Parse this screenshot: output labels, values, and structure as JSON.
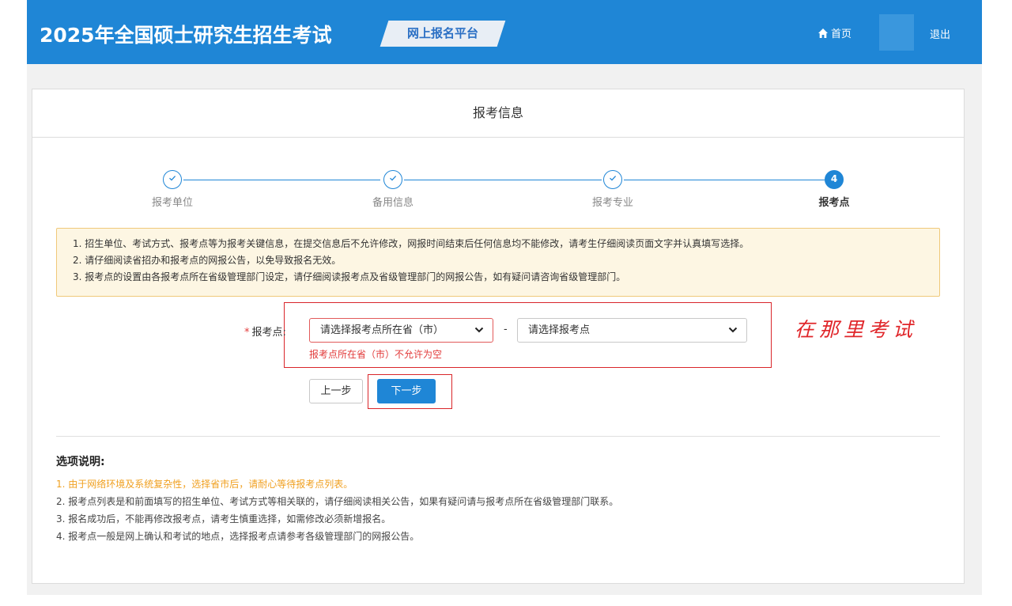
{
  "header": {
    "title": "2025年全国硕士研究生招生考试",
    "platform": "网上报名平台",
    "home_label": "首页",
    "logout_label": "退出",
    "bg_color": "#1f86d6"
  },
  "card": {
    "title": "报考信息"
  },
  "steps": [
    {
      "label": "报考单位",
      "status": "done",
      "icon": "check-icon"
    },
    {
      "label": "备用信息",
      "status": "done",
      "icon": "check-icon"
    },
    {
      "label": "报考专业",
      "status": "done",
      "icon": "check-icon"
    },
    {
      "label": "报考点",
      "status": "active",
      "number": "4"
    }
  ],
  "notice": [
    "1. 招生单位、考试方式、报考点等为报考关键信息，在提交信息后不允许修改，网报时间结束后任何信息均不能修改，请考生仔细阅读页面文字并认真填写选择。",
    "2. 请仔细阅读省招办和报考点的网报公告，以免导致报名无效。",
    "3. 报考点的设置由各报考点所在省级管理部门设定，请仔细阅读报考点及省级管理部门的网报公告，如有疑问请咨询省级管理部门。"
  ],
  "form": {
    "required_mark": "*",
    "label": "报考点:",
    "province_select": "请选择报考点所在省（市）",
    "separator": "-",
    "point_select": "请选择报考点",
    "error": "报考点所在省（市）不允许为空"
  },
  "annotation": "在那里考试",
  "buttons": {
    "prev": "上一步",
    "next": "下一步"
  },
  "options": {
    "title": "选项说明:",
    "items": [
      "1. 由于网络环境及系统复杂性，选择省市后，请耐心等待报考点列表。",
      "2. 报考点列表是和前面填写的招生单位、考试方式等相关联的，请仔细阅读相关公告，如果有疑问请与报考点所在省级管理部门联系。",
      "3. 报名成功后，不能再修改报考点，请考生慎重选择，如需修改必须新增报名。",
      "4. 报考点一般是网上确认和考试的地点，选择报考点请参考各级管理部门的网报公告。"
    ]
  }
}
